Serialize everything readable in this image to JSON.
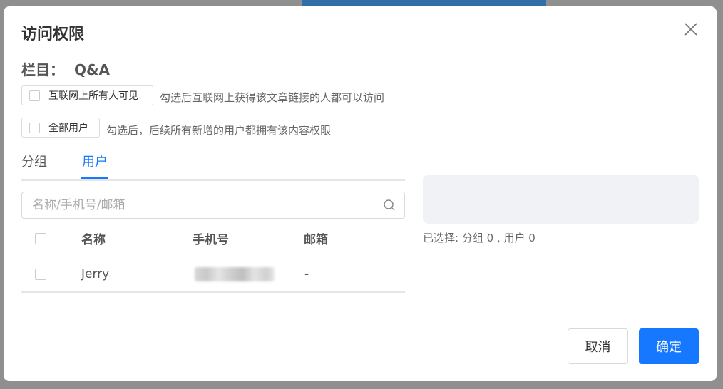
{
  "modal": {
    "title": "访问权限",
    "section_label": "栏目：",
    "section_value": "Q&A"
  },
  "options": [
    {
      "label": "互联网上所有人可见",
      "hint": "勾选后互联网上获得该文章链接的人都可以访问",
      "checked": false
    },
    {
      "label": "全部用户",
      "hint": "勾选后，后续所有新增的用户都拥有该内容权限",
      "checked": false
    }
  ],
  "tabs": [
    {
      "label": "分组",
      "active": false
    },
    {
      "label": "用户",
      "active": true
    }
  ],
  "search": {
    "placeholder": "名称/手机号/邮箱",
    "value": ""
  },
  "table": {
    "headers": [
      "名称",
      "手机号",
      "邮箱"
    ],
    "rows": [
      {
        "name": "Jerry",
        "phone": "",
        "email": "-"
      }
    ]
  },
  "selection": {
    "summary": "已选择: 分组 0 , 用户 0"
  },
  "buttons": {
    "cancel": "取消",
    "confirm": "确定"
  },
  "colors": {
    "accent": "#1677ff",
    "overlay": "#8f8f8f"
  },
  "icons": {
    "close": "close-icon",
    "search": "search-icon"
  }
}
